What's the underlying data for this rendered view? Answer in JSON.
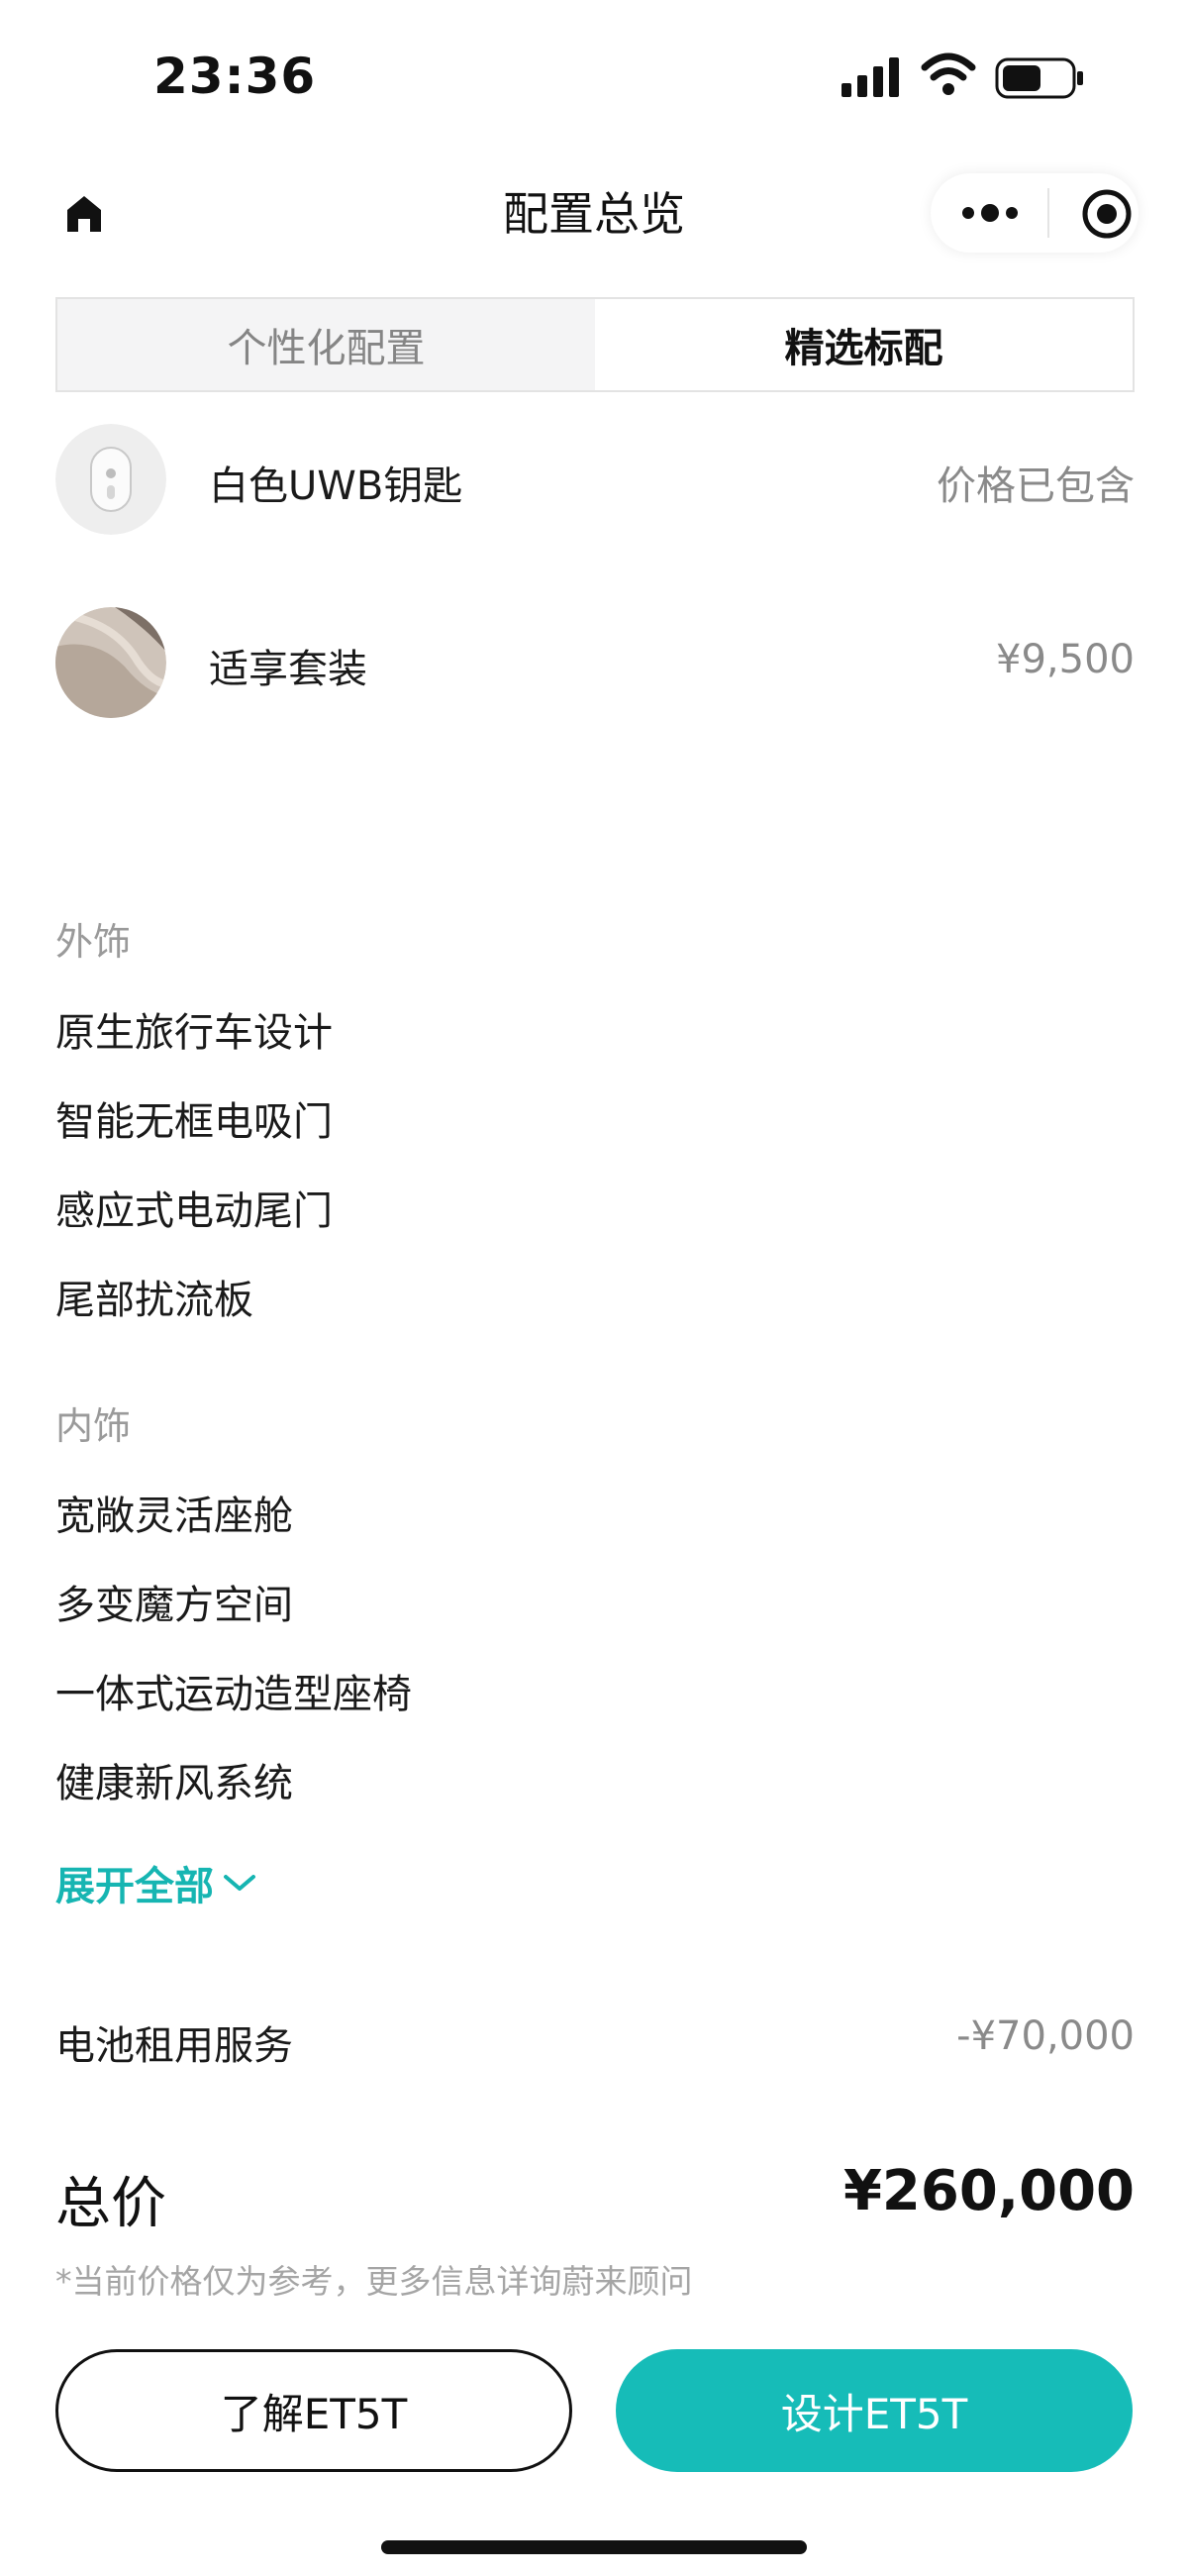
{
  "status_bar": {
    "time": "23:36"
  },
  "nav": {
    "title": "配置总览"
  },
  "tabs": [
    {
      "label": "个性化配置",
      "active": false
    },
    {
      "label": "精选标配",
      "active": true
    }
  ],
  "selected_items": [
    {
      "name": "白色UWB钥匙",
      "price": "价格已包含",
      "thumbnail": "white-key-fob"
    },
    {
      "name": "适享套装",
      "price": "¥9,500",
      "thumbnail": "seat-package"
    }
  ],
  "sections": [
    {
      "title": "外饰",
      "features": [
        "原生旅行车设计",
        "智能无框电吸门",
        "感应式电动尾门",
        "尾部扰流板"
      ]
    },
    {
      "title": "内饰",
      "features": [
        "宽敞灵活座舱",
        "多变魔方空间",
        "一体式运动造型座椅",
        "健康新风系统"
      ]
    }
  ],
  "expand_label": "展开全部",
  "battery_service": {
    "label": "电池租用服务",
    "price": "-¥70,000"
  },
  "total": {
    "label": "总价",
    "value": "¥260,000"
  },
  "disclaimer": "*当前价格仅为参考，更多信息详询蔚来顾问",
  "buttons": {
    "learn": "了解ET5T",
    "design": "设计ET5T"
  },
  "colors": {
    "accent": "#16bcb8",
    "link": "#16b5b2"
  }
}
